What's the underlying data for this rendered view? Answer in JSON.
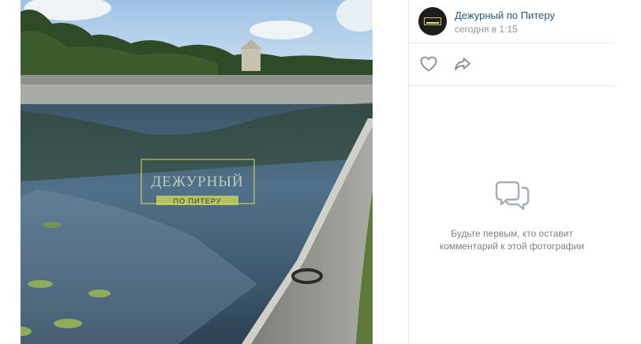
{
  "post": {
    "author_name": "Дежурный по Питеру",
    "time": "сегодня в 1:15",
    "photo": {
      "watermark_title": "ДЕЖУРНЫЙ",
      "watermark_subtitle": "ПО ПИТЕРУ"
    }
  },
  "actions": {
    "like_icon": "heart-icon",
    "share_icon": "share-arrow-icon"
  },
  "comments": {
    "empty_icon": "comment-bubbles-icon",
    "empty_text": "Будьте первым, кто оставит комментарий к этой фотографии"
  },
  "colors": {
    "link": "#2a5885",
    "muted": "#939393",
    "icon": "#828a99",
    "watermark": "#d6dd5a"
  }
}
